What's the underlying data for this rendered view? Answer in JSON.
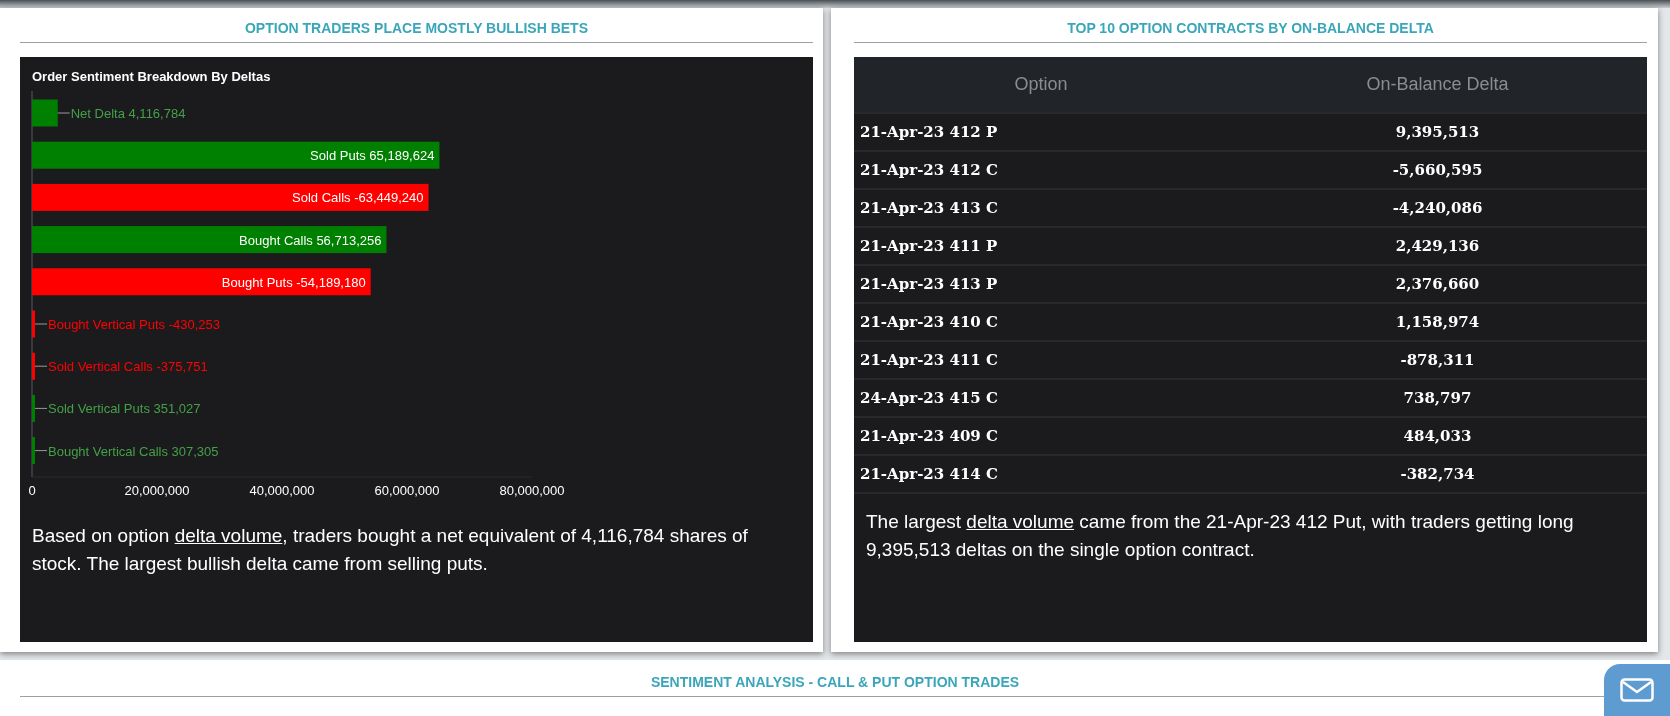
{
  "panels": [
    {
      "title": "OPTION TRADERS PLACE MOSTLY BULLISH BETS",
      "chart_data": {
        "type": "bar",
        "orientation": "horizontal",
        "title": "Order Sentiment Breakdown By Deltas",
        "values": [
          4116784,
          65189624,
          63449240,
          56713256,
          54189180,
          430253,
          375751,
          351027,
          307305
        ],
        "colors": [
          "#008000",
          "#008000",
          "#ff0000",
          "#008000",
          "#ff0000",
          "#ff0000",
          "#ff0000",
          "#008000",
          "#008000"
        ],
        "categories": [
          "Net Delta 4,116,784",
          "Sold Puts 65,189,624",
          "Sold Calls -63,449,240",
          "Bought Calls 56,713,256",
          "Bought Puts -54,189,180",
          "Bought Vertical Puts -430,253",
          "Sold Vertical Calls -375,751",
          "Sold Vertical Puts 351,027",
          "Bought Vertical Calls 307,305"
        ],
        "xlim": [
          0,
          80000000
        ],
        "xticks": [
          {
            "value": 0,
            "label": "0"
          },
          {
            "value": 20000000,
            "label": "20,000,000"
          },
          {
            "value": 40000000,
            "label": "40,000,000"
          },
          {
            "value": 60000000,
            "label": "60,000,000"
          },
          {
            "value": 80000000,
            "label": "80,000,000"
          }
        ]
      },
      "summary": {
        "before": "Based on option ",
        "link": "delta volume",
        "after": ", traders bought a net equivalent of 4,116,784 shares of stock. The largest bullish delta came from selling puts."
      }
    },
    {
      "title": "TOP 10 OPTION CONTRACTS BY ON-BALANCE DELTA",
      "table": {
        "columns": [
          "Option",
          "On-Balance Delta"
        ],
        "rows": [
          [
            "21-Apr-23 412 P",
            "9,395,513"
          ],
          [
            "21-Apr-23 412 C",
            "-5,660,595"
          ],
          [
            "21-Apr-23 413 C",
            "-4,240,086"
          ],
          [
            "21-Apr-23 411 P",
            "2,429,136"
          ],
          [
            "21-Apr-23 413 P",
            "2,376,660"
          ],
          [
            "21-Apr-23 410 C",
            "1,158,974"
          ],
          [
            "21-Apr-23 411 C",
            "-878,311"
          ],
          [
            "24-Apr-23 415 C",
            "738,797"
          ],
          [
            "21-Apr-23 409 C",
            "484,033"
          ],
          [
            "21-Apr-23 414 C",
            "-382,734"
          ]
        ]
      },
      "summary": {
        "before": "The largest ",
        "link": "delta volume",
        "after": " came from the 21-Apr-23 412 Put, with traders getting long 9,395,513 deltas on the single option contract."
      }
    }
  ],
  "section": {
    "title": "SENTIMENT ANALYSIS - CALL & PUT OPTION TRADES"
  }
}
